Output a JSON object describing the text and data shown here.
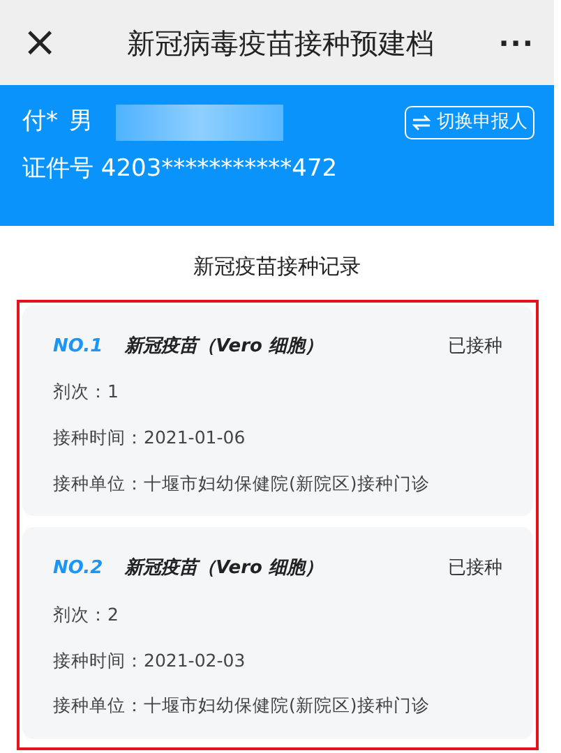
{
  "header": {
    "close": "×",
    "title": "新冠病毒疫苗接种预建档",
    "more": "···"
  },
  "person": {
    "name": "付*",
    "gender": "男",
    "id_line": "证件号 4203***********472",
    "switch_button": "切换申报人"
  },
  "section_title": "新冠疫苗接种记录",
  "records": [
    {
      "number": "NO.1",
      "vaccine": "新冠疫苗（Vero 细胞）",
      "status": "已接种",
      "dose": "剂次：1",
      "time": "接种时间：2021-01-06",
      "unit": "接种单位：十堰市妇幼保健院(新院区)接种门诊"
    },
    {
      "number": "NO.2",
      "vaccine": "新冠疫苗（Vero 细胞）",
      "status": "已接种",
      "dose": "剂次：2",
      "time": "接种时间：2021-02-03",
      "unit": "接种单位：十堰市妇幼保健院(新院区)接种门诊"
    }
  ]
}
